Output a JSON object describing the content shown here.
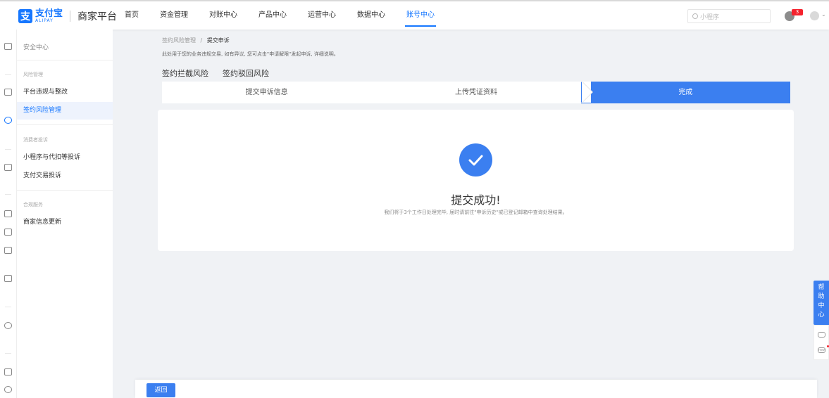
{
  "header": {
    "logo_cn": "支付宝",
    "logo_en": "ALIPAY",
    "platform": "商家平台",
    "nav": [
      "首页",
      "资金管理",
      "对账中心",
      "产品中心",
      "运营中心",
      "数据中心",
      "账号中心"
    ],
    "active_nav": "账号中心",
    "search_placeholder": "小程序",
    "badge": "3"
  },
  "sidebar": {
    "title": "安全中心",
    "groups": [
      {
        "name": "风险管理",
        "items": [
          "平台违规与整改",
          "签约风险管理"
        ]
      },
      {
        "name": "消费者投诉",
        "items": [
          "小程序与代扣等投诉",
          "支付交易投诉"
        ]
      },
      {
        "name": "合规服务",
        "items": [
          "商家信息更新"
        ]
      }
    ],
    "active_item": "签约风险管理"
  },
  "breadcrumb": {
    "parent": "签约风险管理",
    "sep": "/",
    "current": "提交申诉"
  },
  "description": "此处用于您的业务违规交易, 如有异议, 您可点击\"申请解限\"发起申诉, 详细说明。",
  "tabs": [
    "签约拦截风险",
    "签约驳回风险"
  ],
  "steps": [
    "提交申诉信息",
    "上传凭证资料",
    "完成"
  ],
  "result": {
    "title": "提交成功!",
    "desc": "我们将于3个工作日处理完毕, 届时请前往\"申诉历史\"或已登记邮箱中查询处理结果。"
  },
  "help": {
    "label": "帮助中心",
    "new_label": "new"
  },
  "footer": {
    "back_label": "返回"
  },
  "colors": {
    "primary": "#1677ff",
    "step_done": "#3b7ff0",
    "badge": "#f5222d"
  }
}
